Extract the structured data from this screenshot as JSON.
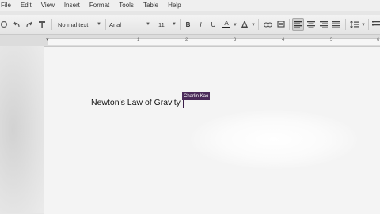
{
  "menubar": {
    "items": [
      "File",
      "Edit",
      "View",
      "Insert",
      "Format",
      "Tools",
      "Table",
      "Help"
    ]
  },
  "toolbar": {
    "style_value": "Normal text",
    "font_value": "Arial",
    "size_value": "11",
    "bold": "B",
    "italic": "I",
    "underline": "U",
    "text_color": "A"
  },
  "ruler": {
    "numbers": [
      "1",
      "2",
      "3",
      "4",
      "5",
      "6"
    ]
  },
  "document": {
    "text": "Newton's Law of Gravity",
    "collaborator": "Charlin Kao",
    "collaborator_color": "#4b2b5a"
  }
}
